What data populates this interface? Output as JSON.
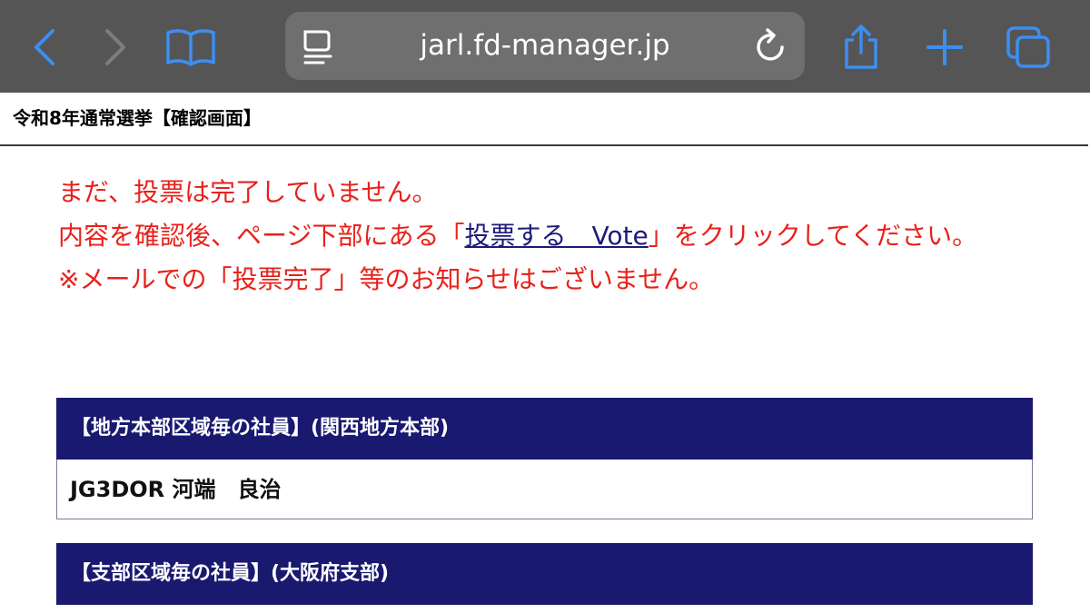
{
  "browser": {
    "url": "jarl.fd-manager.jp",
    "icons": [
      "back-icon",
      "forward-icon",
      "bookmarks-icon",
      "reader-icon",
      "reload-icon",
      "share-icon",
      "new-tab-icon",
      "tabs-icon"
    ],
    "colors": {
      "toolbar": "#555555",
      "urlbar": "#6f6f6f",
      "accent": "#2f80ed"
    }
  },
  "page": {
    "title": "令和8年通常選挙【確認画面】",
    "notice": {
      "line1": "まだ、投票は完了していません。",
      "line2_before": "内容を確認後、ページ下部にある「",
      "line2_link": "投票する　Vote",
      "line2_after": "」をクリックしてください。",
      "line3": "※メールでの「投票完了」等のお知らせはございません。",
      "color": "#e8211b"
    },
    "sections": [
      {
        "header": "【地方本部区域毎の社員】(関西地方本部)",
        "value": "JG3DOR 河端　良治"
      },
      {
        "header": "【支部区域毎の社員】(大阪府支部)",
        "value": ""
      }
    ],
    "header_color": "#191970"
  }
}
